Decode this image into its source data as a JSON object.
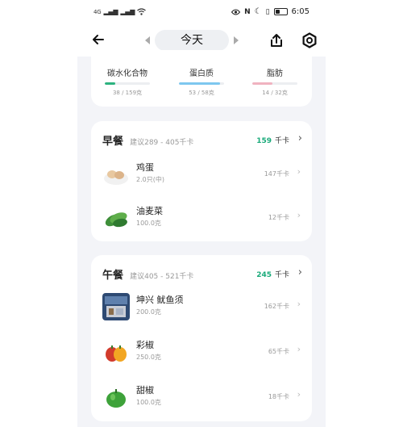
{
  "status_bar": {
    "left_text": "4G",
    "time": "6:05"
  },
  "nav": {
    "date_label": "今天"
  },
  "macros": [
    {
      "name": "碳水化合物",
      "value": "38 / 159克",
      "progress": 0.24,
      "color": "#2db37f"
    },
    {
      "name": "蛋白质",
      "value": "53 / 58克",
      "progress": 0.91,
      "color": "#7ec7ef"
    },
    {
      "name": "脂肪",
      "value": "14 / 32克",
      "progress": 0.44,
      "color": "#f0b3c0"
    }
  ],
  "meals": [
    {
      "title": "早餐",
      "suggest": "建议289 - 405千卡",
      "kcal": "159",
      "kcal_unit": "千卡",
      "foods": [
        {
          "name": "鸡蛋",
          "qty": "2.0只(中)",
          "kcal": "147千卡",
          "icon": "eggs-image"
        },
        {
          "name": "油麦菜",
          "qty": "100.0克",
          "kcal": "12千卡",
          "icon": "lettuce-image"
        }
      ]
    },
    {
      "title": "午餐",
      "suggest": "建议405 - 521千卡",
      "kcal": "245",
      "kcal_unit": "千卡",
      "foods": [
        {
          "name": "坤兴 鱿鱼须",
          "qty": "200.0克",
          "kcal": "162千卡",
          "icon": "squid-package-image"
        },
        {
          "name": "彩椒",
          "qty": "250.0克",
          "kcal": "65千卡",
          "icon": "bell-pepper-image"
        },
        {
          "name": "甜椒",
          "qty": "100.0克",
          "kcal": "18千卡",
          "icon": "green-pepper-image"
        }
      ]
    }
  ],
  "colors": {
    "accent": "#1aaa7a",
    "background": "#f3f4f8"
  }
}
